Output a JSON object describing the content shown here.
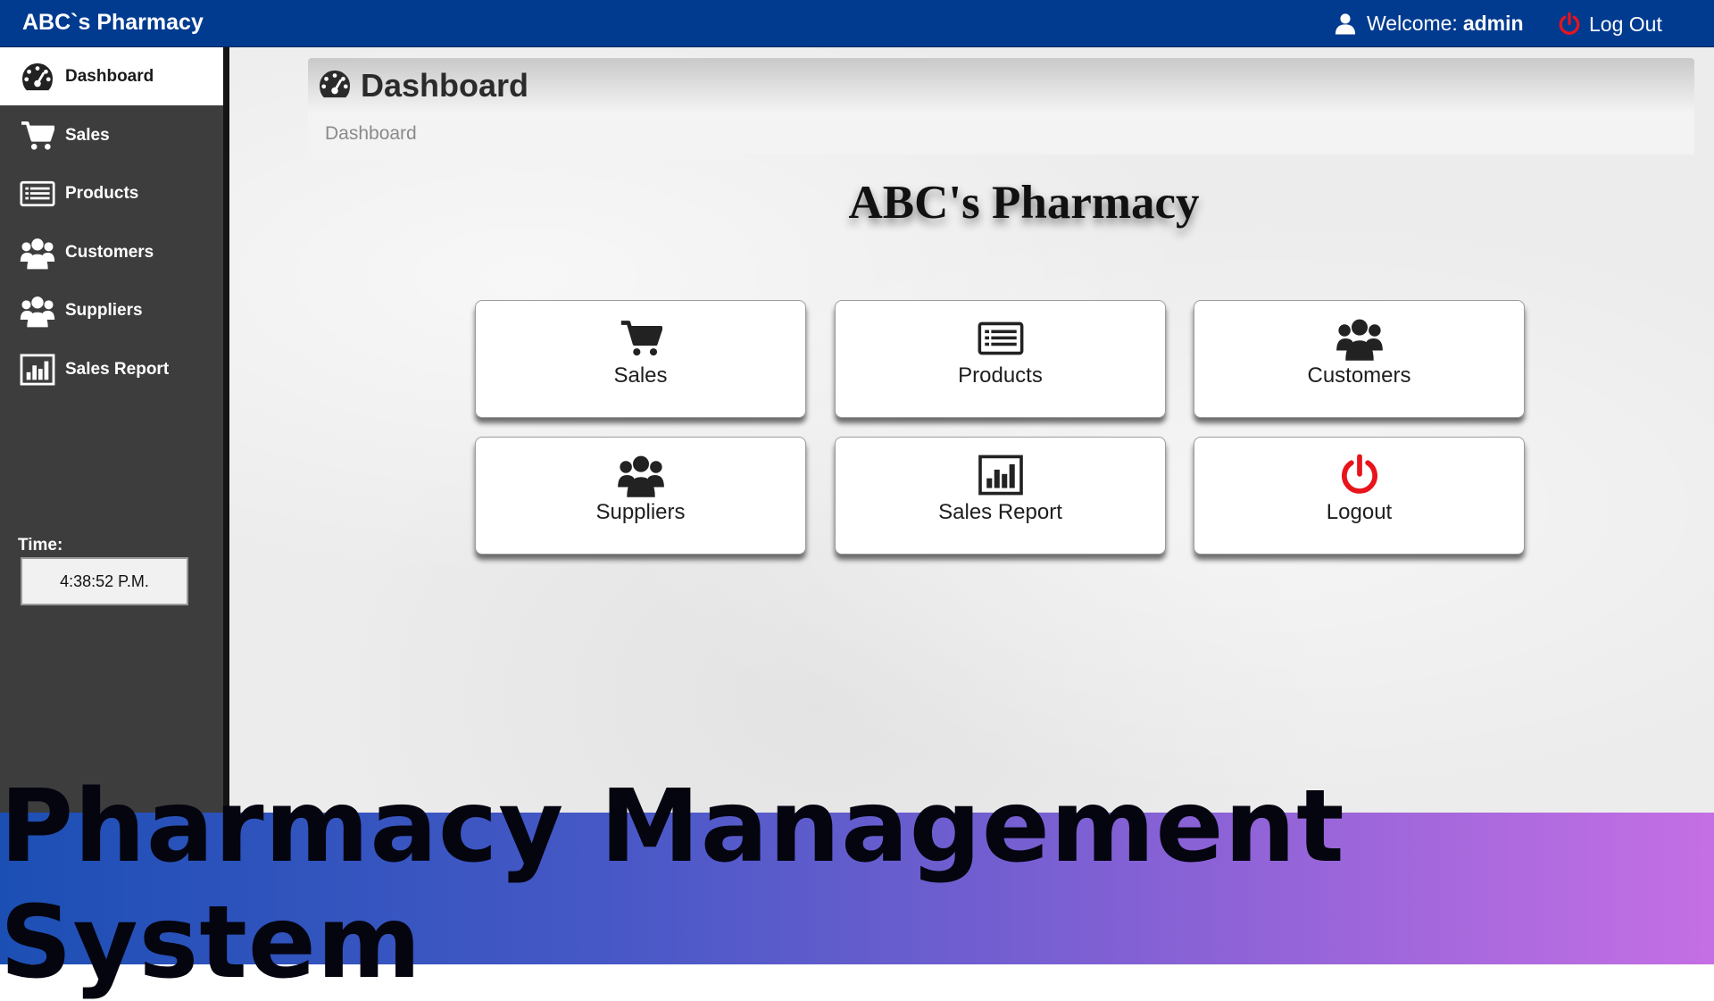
{
  "topbar": {
    "brand": "ABC`s Pharmacy",
    "welcome_prefix": "Welcome:",
    "username": "admin",
    "logout_label": "Log Out"
  },
  "sidebar": {
    "items": [
      {
        "label": "Dashboard",
        "icon": "dashboard-icon",
        "active": true
      },
      {
        "label": "Sales",
        "icon": "cart-icon"
      },
      {
        "label": "Products",
        "icon": "list-icon"
      },
      {
        "label": "Customers",
        "icon": "users-icon"
      },
      {
        "label": "Suppliers",
        "icon": "users-icon"
      },
      {
        "label": "Sales Report",
        "icon": "bar-chart-icon"
      }
    ],
    "time_label": "Time:",
    "time_value": "4:38:52 P.M."
  },
  "main": {
    "panel_title": "Dashboard",
    "breadcrumb": "Dashboard",
    "heading": "ABC's Pharmacy",
    "tiles": [
      {
        "label": "Sales",
        "icon": "cart-icon"
      },
      {
        "label": "Products",
        "icon": "list-icon"
      },
      {
        "label": "Customers",
        "icon": "users-icon"
      },
      {
        "label": "Suppliers",
        "icon": "users-icon"
      },
      {
        "label": "Sales Report",
        "icon": "bar-chart-icon"
      },
      {
        "label": "Logout",
        "icon": "power-icon"
      }
    ]
  },
  "banner": {
    "text": "Pharmacy Management System"
  },
  "colors": {
    "topbar": "#003b90",
    "sidebar": "#3d3d3d",
    "logout_red": "#e8141b"
  }
}
